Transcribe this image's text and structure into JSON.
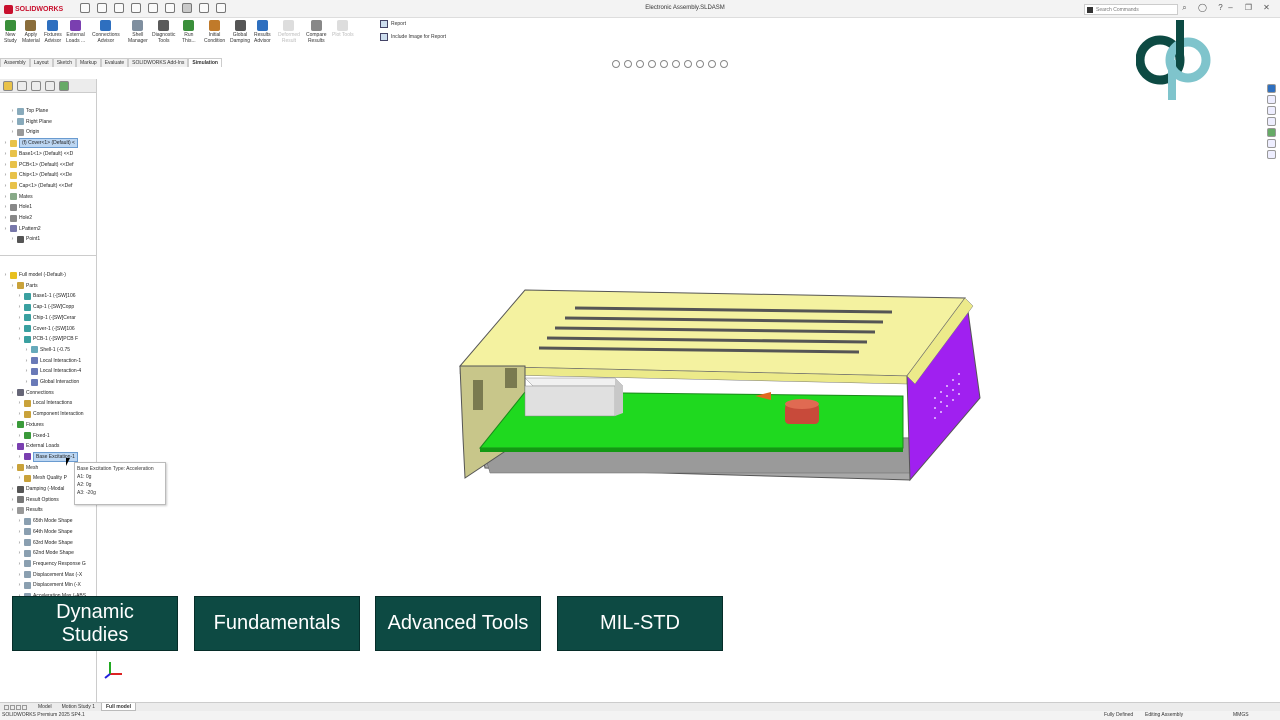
{
  "window": {
    "title": "Electronic Assembly.SLDASM",
    "brand": "SOLIDWORKS",
    "search_placeholder": "Search Commands"
  },
  "ribbon": {
    "buttons": [
      {
        "label": "New\nStudy",
        "color": "#3a8f3a"
      },
      {
        "label": "Apply\nMaterial",
        "color": "#8a6d3b"
      },
      {
        "label": "Fixtures\nAdvisor",
        "color": "#2e6fbf"
      },
      {
        "label": "External\nLoads ...",
        "color": "#7a3fb0"
      },
      {
        "label": "Connections\nAdvisor",
        "color": "#2e6fbf"
      },
      {
        "label": "Shell\nManager",
        "color": "#7f8f9f"
      },
      {
        "label": "Diagnostic\nTools",
        "color": "#5a5a5a"
      },
      {
        "label": "Run\nThis...",
        "color": "#3a8f3a"
      },
      {
        "label": "Initial\nCondition",
        "color": "#c07a2a"
      },
      {
        "label": "Global\nDamping",
        "color": "#555"
      },
      {
        "label": "Results\nAdvisor",
        "color": "#2e6fbf"
      },
      {
        "label": "Deformed\nResult",
        "color": "#bbb",
        "disabled": true
      },
      {
        "label": "Compare\nResults",
        "color": "#888"
      },
      {
        "label": "Plot Tools",
        "color": "#bbb",
        "disabled": true
      }
    ],
    "report": "Report",
    "include_image": "Include Image for Report"
  },
  "command_tabs": [
    "Assembly",
    "Layout",
    "Sketch",
    "Markup",
    "Evaluate",
    "SOLIDWORKS Add-Ins",
    "Simulation"
  ],
  "active_command_tab": "Simulation",
  "feature_tree": [
    {
      "label": "Top Plane",
      "indent": 1,
      "icon": "plane"
    },
    {
      "label": "Right Plane",
      "indent": 1,
      "icon": "plane"
    },
    {
      "label": "Origin",
      "indent": 1,
      "icon": "origin"
    },
    {
      "label": "(f) Cover<1> (Default) <",
      "indent": 0,
      "icon": "part",
      "selected": true
    },
    {
      "label": "Base1<1> (Default) <<D",
      "indent": 0,
      "icon": "part"
    },
    {
      "label": "PCB<1> (Default) <<Def",
      "indent": 0,
      "icon": "part"
    },
    {
      "label": "Chip<1> (Default) <<De",
      "indent": 0,
      "icon": "part"
    },
    {
      "label": "Cap<1> (Default) <<Def",
      "indent": 0,
      "icon": "part"
    },
    {
      "label": "Mates",
      "indent": 0,
      "icon": "mates"
    },
    {
      "label": "Hole1",
      "indent": 0,
      "icon": "hole"
    },
    {
      "label": "Hole2",
      "indent": 0,
      "icon": "hole"
    },
    {
      "label": "LPattern2",
      "indent": 0,
      "icon": "pattern"
    },
    {
      "label": "Point1",
      "indent": 1,
      "icon": "point"
    }
  ],
  "study_tree": [
    {
      "label": "Full model (-Default-)",
      "indent": 0,
      "icon": "warn"
    },
    {
      "label": "Parts",
      "indent": 1,
      "icon": "parts"
    },
    {
      "label": "Base1-1 (-[SW]106",
      "indent": 2,
      "icon": "solid"
    },
    {
      "label": "Cap-1 (-[SW]Copp",
      "indent": 2,
      "icon": "solid"
    },
    {
      "label": "Chip-1 (-[SW]Cerar",
      "indent": 2,
      "icon": "solid"
    },
    {
      "label": "Cover-1 (-[SW]106",
      "indent": 2,
      "icon": "solid"
    },
    {
      "label": "PCB-1 (-[SW]PCB F",
      "indent": 2,
      "icon": "solid"
    },
    {
      "label": "Shell-1 (-0.75",
      "indent": 3,
      "icon": "shell"
    },
    {
      "label": "Local Interaction-1",
      "indent": 3,
      "icon": "interaction"
    },
    {
      "label": "Local Interaction-4",
      "indent": 3,
      "icon": "interaction"
    },
    {
      "label": "Global Interaction",
      "indent": 3,
      "icon": "interaction"
    },
    {
      "label": "Connections",
      "indent": 1,
      "icon": "connections"
    },
    {
      "label": "Local Interactions",
      "indent": 2,
      "icon": "folder"
    },
    {
      "label": "Component Interaction",
      "indent": 2,
      "icon": "folder"
    },
    {
      "label": "Fixtures",
      "indent": 1,
      "icon": "fixture"
    },
    {
      "label": "Fixed-1",
      "indent": 2,
      "icon": "fixture"
    },
    {
      "label": "External Loads",
      "indent": 1,
      "icon": "load"
    },
    {
      "label": "Base Excitation-1",
      "indent": 2,
      "icon": "load",
      "selected": true
    },
    {
      "label": "Mesh",
      "indent": 1,
      "icon": "mesh"
    },
    {
      "label": "Mesh Quality P",
      "indent": 2,
      "icon": "mesh"
    },
    {
      "label": "Damping (-Modal",
      "indent": 1,
      "icon": "damping"
    },
    {
      "label": "Result Options",
      "indent": 1,
      "icon": "options"
    },
    {
      "label": "Results",
      "indent": 1,
      "icon": "results"
    },
    {
      "label": "65th Mode Shape",
      "indent": 2,
      "icon": "plot"
    },
    {
      "label": "64th Mode Shape",
      "indent": 2,
      "icon": "plot"
    },
    {
      "label": "63rd Mode Shape",
      "indent": 2,
      "icon": "plot"
    },
    {
      "label": "62nd Mode Shape",
      "indent": 2,
      "icon": "plot"
    },
    {
      "label": "Frequency Response G",
      "indent": 2,
      "icon": "plot"
    },
    {
      "label": "Displacement Max (-X",
      "indent": 2,
      "icon": "plot"
    },
    {
      "label": "Displacement Min (-X",
      "indent": 2,
      "icon": "plot"
    },
    {
      "label": "Acceleration Max (-ABS",
      "indent": 2,
      "icon": "plot"
    }
  ],
  "tooltip": {
    "title": "Base Excitation Type: Acceleration",
    "lines": [
      "A1: 0g",
      "A2: 0g",
      "A3: -20g"
    ]
  },
  "overlay_buttons": [
    {
      "label": "Dynamic\nStudies"
    },
    {
      "label": "Fundamentals"
    },
    {
      "label": "Advanced Tools"
    },
    {
      "label": "MIL-STD"
    }
  ],
  "bottom_tabs": [
    "Model",
    "Motion Study 1",
    "Full model"
  ],
  "active_bottom_tab": "Full model",
  "status": {
    "left": "SOLIDWORKS Premium 2025 SP4.1",
    "state": "Fully Defined",
    "mode": "Editing Assembly",
    "units": "MMGS"
  },
  "colors": {
    "accent_button": "#0d4a43",
    "cover": "#f4f2a0",
    "side_panel": "#a020f0",
    "pcb": "#1fd91f",
    "cap": "#c84a3a",
    "chip": "#e0e0e0"
  }
}
